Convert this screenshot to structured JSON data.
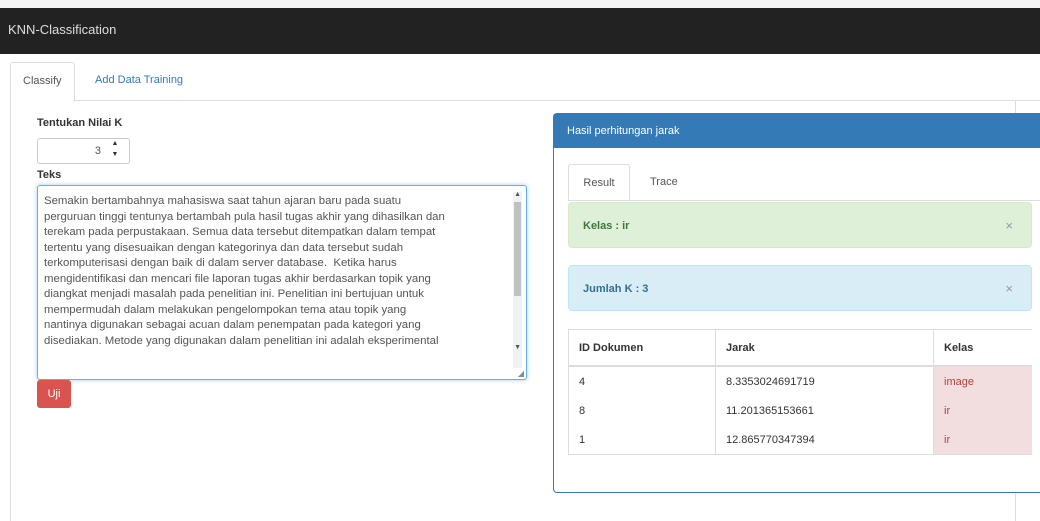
{
  "app": {
    "title": "KNN-Classification"
  },
  "tabs": [
    {
      "label": "Classify",
      "active": true
    },
    {
      "label": "Add Data Training",
      "active": false
    }
  ],
  "form": {
    "k_label": "Tentukan Nilai K",
    "k_value": "3",
    "text_label": "Teks",
    "text_value": "Semakin bertambahnya mahasiswa saat tahun ajaran baru pada suatu\nperguruan tinggi tentunya bertambah pula hasil tugas akhir yang dihasilkan dan\nterekam pada perpustakaan. Semua data tersebut ditempatkan dalam tempat\ntertentu yang disesuaikan dengan kategorinya dan data tersebut sudah\nterkomputerisasi dengan baik di dalam server database.  Ketika harus\nmengidentifikasi dan mencari file laporan tugas akhir berdasarkan topik yang\ndiangkat menjadi masalah pada penelitian ini. Penelitian ini bertujuan untuk\nmempermudah dalam melakukan pengelompokan tema atau topik yang\nnantinya digunakan sebagai acuan dalam penempatan pada kategori yang\ndisediakan. Metode yang digunakan dalam penelitian ini adalah eksperimental",
    "submit_label": "Uji"
  },
  "result_panel": {
    "heading": "Hasil perhitungan jarak",
    "tabs": [
      {
        "label": "Result",
        "active": true
      },
      {
        "label": "Trace",
        "active": false
      }
    ],
    "alert_class": "Kelas : ir",
    "alert_k": "Jumlah K : 3",
    "close_symbol": "×",
    "table": {
      "headers": [
        "ID Dokumen",
        "Jarak",
        "Kelas"
      ],
      "rows": [
        {
          "id": "4",
          "jarak": "8.3353024691719",
          "kelas": "image"
        },
        {
          "id": "8",
          "jarak": "11.201365153661",
          "kelas": "ir"
        },
        {
          "id": "1",
          "jarak": "12.865770347394",
          "kelas": "ir"
        }
      ]
    }
  },
  "colors": {
    "navbar": "#222222",
    "primary": "#337ab7",
    "danger": "#d9534f",
    "success_bg": "#dff0d8",
    "info_bg": "#d9edf7",
    "danger_bg": "#f2dede"
  }
}
